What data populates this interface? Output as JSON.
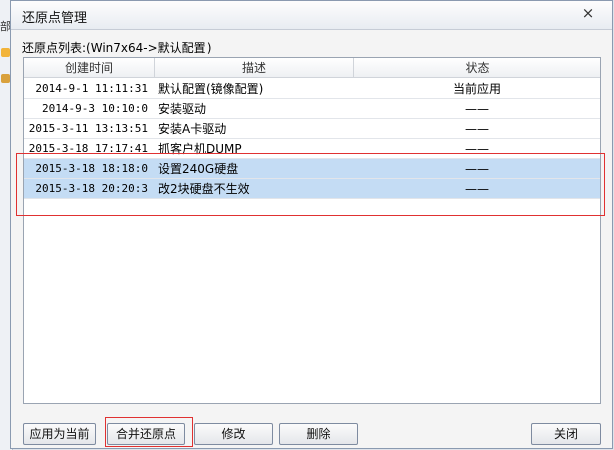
{
  "window": {
    "title": "还原点管理",
    "close_glyph": "×"
  },
  "list_caption": {
    "prefix": "还原点列表:(Win7x64->",
    "profile": "默认配置",
    "suffix": ")"
  },
  "table": {
    "columns": [
      "创建时间",
      "描述",
      "状态"
    ],
    "rows": [
      {
        "time": "2014-9-1 11:11:31",
        "desc": "默认配置(镜像配置)",
        "status": "当前应用",
        "selected": false
      },
      {
        "time": "2014-9-3 10:10:0",
        "desc": "安装驱动",
        "status": "——",
        "selected": false
      },
      {
        "time": "2015-3-11 13:13:51",
        "desc": "安装A卡驱动",
        "status": "——",
        "selected": false
      },
      {
        "time": "2015-3-18 17:17:41",
        "desc": "抓客户机DUMP",
        "status": "——",
        "selected": false
      },
      {
        "time": "2015-3-18 18:18:0",
        "desc": "设置240G硬盘",
        "status": "——",
        "selected": true
      },
      {
        "time": "2015-3-18 20:20:3",
        "desc": "改2块硬盘不生效",
        "status": "——",
        "selected": true
      }
    ]
  },
  "buttons": {
    "apply": "应用为当前",
    "merge": "合并还原点",
    "edit": "修改",
    "delete": "删除",
    "close": "关闭"
  },
  "background_app": {
    "tab_label": "部"
  },
  "colors": {
    "selection": "#c4dcf4",
    "highlight_box": "#e03131"
  }
}
